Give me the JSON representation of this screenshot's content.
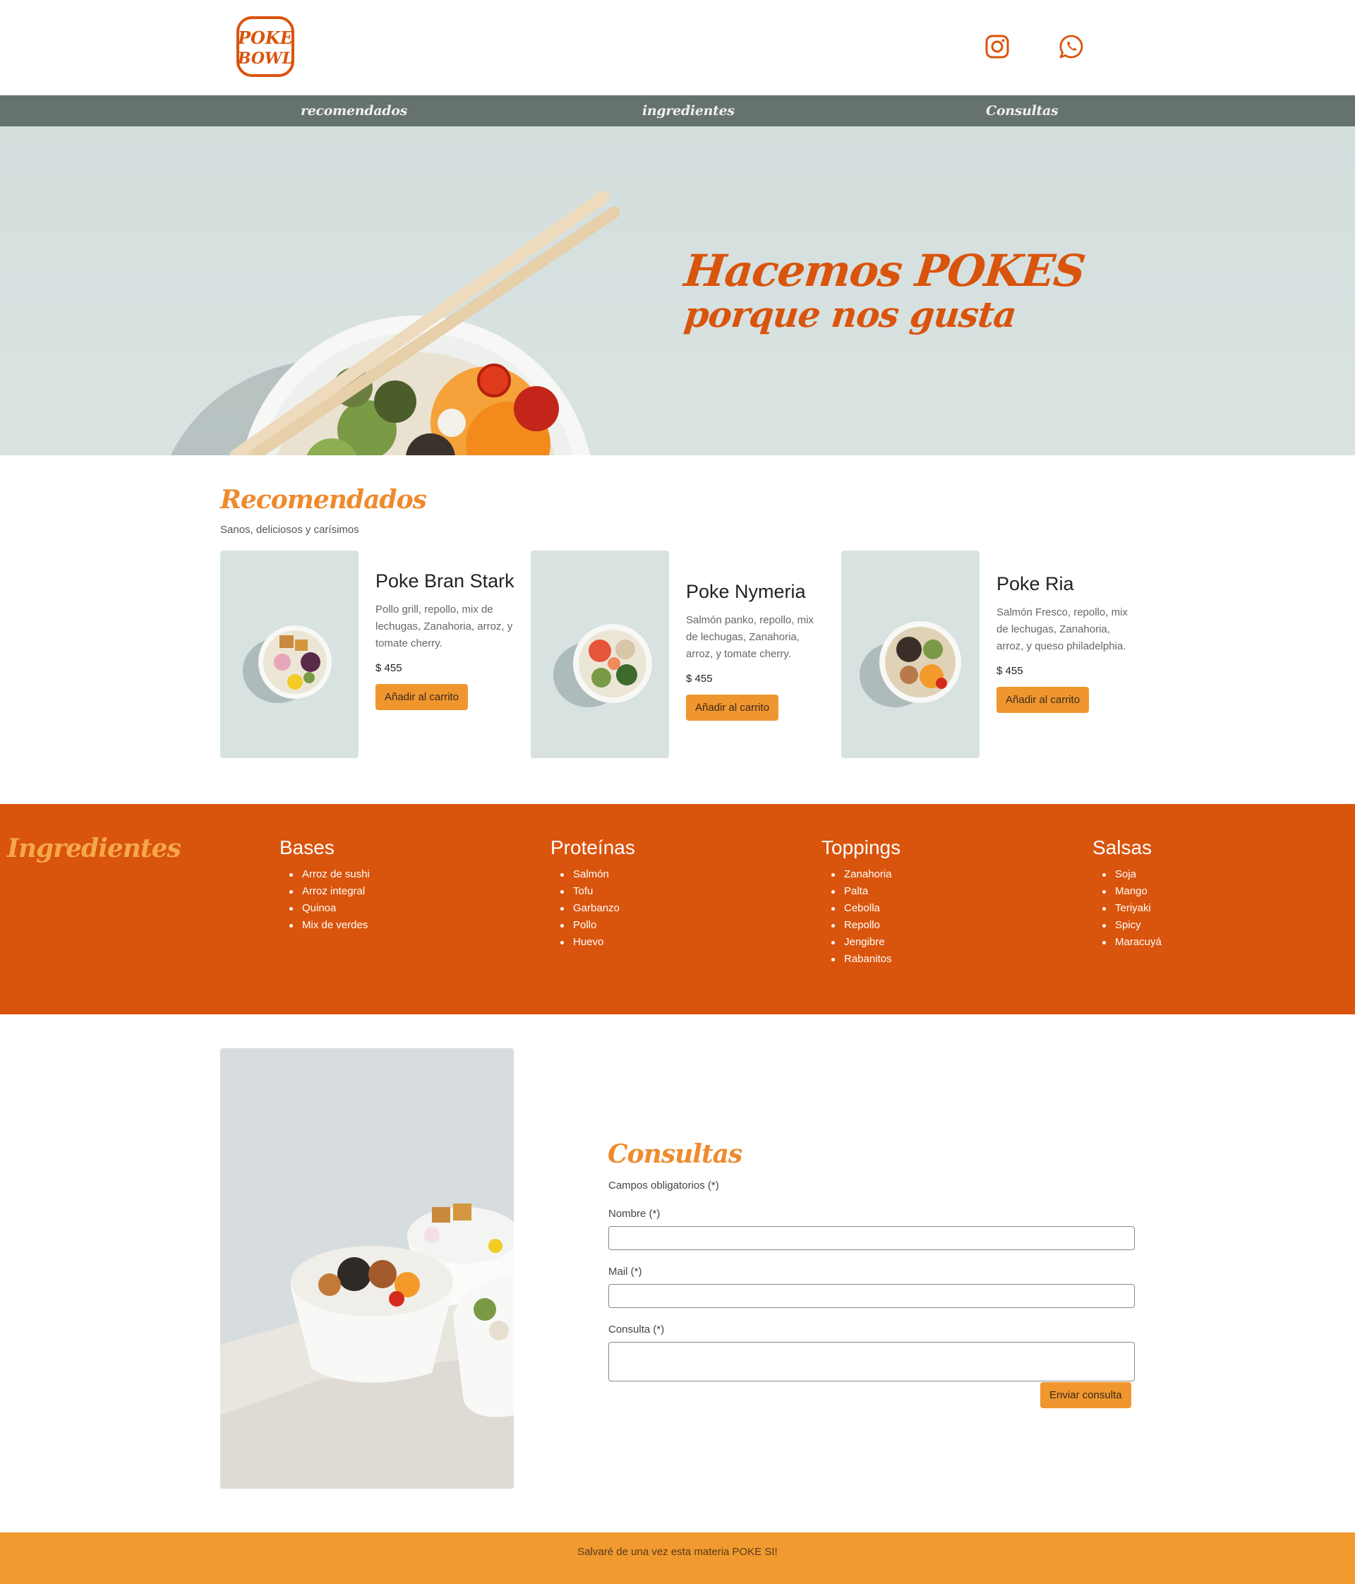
{
  "header": {
    "logo": {
      "line1": "POKE",
      "line2": "BOWL",
      "icon": "poke-bowl-logo"
    },
    "social": [
      {
        "name": "instagram",
        "icon": "instagram-icon"
      },
      {
        "name": "whatsapp",
        "icon": "whatsapp-icon"
      }
    ]
  },
  "nav": {
    "items": [
      {
        "label": "recomendados"
      },
      {
        "label": "ingredientes"
      },
      {
        "label": "Consultas"
      }
    ]
  },
  "hero": {
    "line1": "Hacemos POKES",
    "line2": "porque nos gusta"
  },
  "recomendados": {
    "title": "Recomendados",
    "subtitle": "Sanos, deliciosos y carísimos",
    "cards": [
      {
        "name": "Poke Bran Stark",
        "description": "Pollo grill, repollo, mix de lechugas, Zanahoria, arroz, y tomate cherry.",
        "price": "$ 455",
        "button": "Añadir al carrito"
      },
      {
        "name": "Poke Nymeria",
        "description": "Salmón panko, repollo, mix de lechugas, Zanahoria, arroz, y tomate cherry.",
        "price": "$ 455",
        "button": "Añadir al carrito"
      },
      {
        "name": "Poke Ria",
        "description": "Salmón Fresco, repollo, mix de lechugas, Zanahoria, arroz, y queso philadelphia.",
        "price": "$ 455",
        "button": "Añadir al carrito"
      }
    ]
  },
  "ingredientes": {
    "title": "Ingredientes",
    "columns": [
      {
        "heading": "Bases",
        "items": [
          "Arroz de sushi",
          "Arroz integral",
          "Quinoa",
          "Mix de verdes"
        ]
      },
      {
        "heading": "Proteínas",
        "items": [
          "Salmón",
          "Tofu",
          "Garbanzo",
          "Pollo",
          "Huevo"
        ]
      },
      {
        "heading": "Toppings",
        "items": [
          "Zanahoria",
          "Palta",
          "Cebolla",
          "Repollo",
          "Jengibre",
          "Rabanitos"
        ]
      },
      {
        "heading": "Salsas",
        "items": [
          "Soja",
          "Mango",
          "Teriyaki",
          "Spicy",
          "Maracuyá"
        ]
      }
    ]
  },
  "consultas": {
    "title": "Consultas",
    "required_note": "Campos obligatorios (*)",
    "fields": {
      "nombre": {
        "label": "Nombre (*)",
        "value": "",
        "placeholder": ""
      },
      "mail": {
        "label": "Mail (*)",
        "value": "",
        "placeholder": ""
      },
      "consulta": {
        "label": "Consulta (*)",
        "value": "",
        "placeholder": ""
      }
    },
    "submit": "Enviar consulta"
  },
  "footer": {
    "text": "Salvaré de una vez esta materia POKE SI!"
  },
  "colors": {
    "brand_orange": "#d9540c",
    "accent_orange": "#f0962f",
    "nav_gray": "#66736d",
    "hero_bg": "#d5dfde"
  }
}
